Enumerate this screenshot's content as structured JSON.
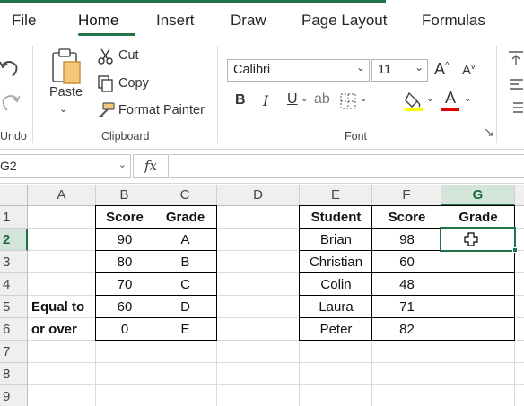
{
  "tabs": [
    "File",
    "Home",
    "Insert",
    "Draw",
    "Page Layout",
    "Formulas"
  ],
  "ribbon": {
    "undo_label": "Undo",
    "paste_label": "Paste",
    "cut_label": "Cut",
    "copy_label": "Copy",
    "format_painter_label": "Format Painter",
    "clipboard_label": "Clipboard",
    "font_name": "Calibri",
    "font_size": "11",
    "font_label": "Font",
    "bold": "B",
    "italic": "I",
    "underline": "U",
    "strike": "ab",
    "grow": "A",
    "shrink": "A",
    "font_color_letter": "A",
    "highlight_color": "#ffff00",
    "font_color": "#e00000"
  },
  "formula_bar": {
    "name_box": "G2",
    "fx": "fx",
    "formula": ""
  },
  "sheet": {
    "columns": [
      "A",
      "B",
      "C",
      "D",
      "E",
      "F",
      "G"
    ],
    "selected_column": "G",
    "rows": [
      "1",
      "2",
      "3",
      "4",
      "5",
      "6",
      "7",
      "8",
      "9"
    ],
    "selected_row": "2",
    "label_line1": "Equal to",
    "label_line2": "or over",
    "table1": {
      "headers": [
        "Score",
        "Grade"
      ],
      "rows": [
        [
          "90",
          "A"
        ],
        [
          "80",
          "B"
        ],
        [
          "70",
          "C"
        ],
        [
          "60",
          "D"
        ],
        [
          "0",
          "E"
        ]
      ]
    },
    "table2": {
      "headers": [
        "Student",
        "Score",
        "Grade"
      ],
      "rows": [
        [
          "Brian",
          "98",
          ""
        ],
        [
          "Christian",
          "60",
          ""
        ],
        [
          "Colin",
          "48",
          ""
        ],
        [
          "Laura",
          "71",
          ""
        ],
        [
          "Peter",
          "82",
          ""
        ]
      ]
    }
  },
  "colors": {
    "accent": "#217346"
  }
}
